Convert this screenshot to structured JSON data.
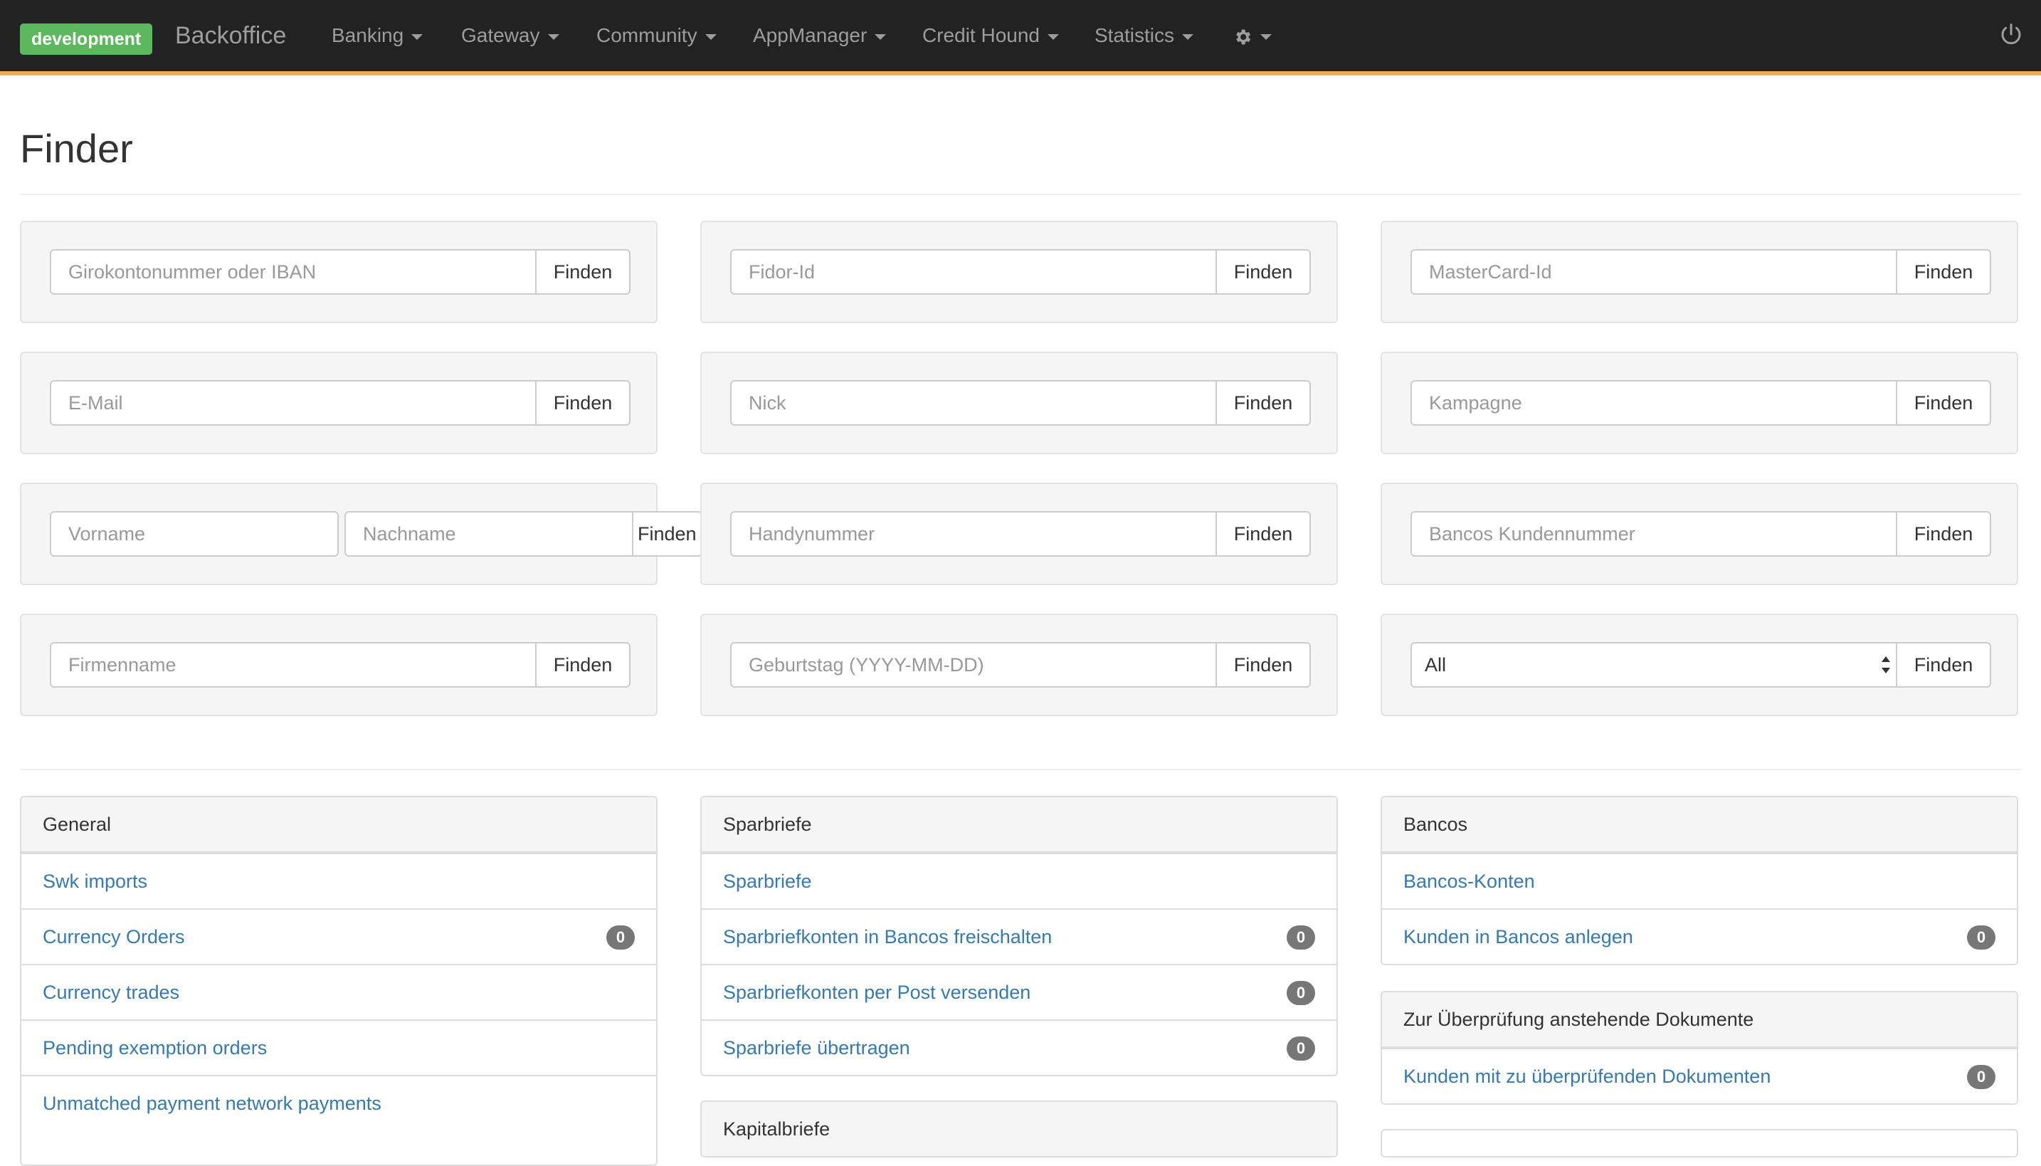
{
  "navbar": {
    "env": "development",
    "brand": "Backoffice",
    "menus": [
      "Banking",
      "Gateway",
      "Community",
      "AppManager",
      "Credit Hound",
      "Statistics"
    ],
    "settings_icon": "gear-icon",
    "logout_icon": "power-icon",
    "accent_color": "#f0ad4e",
    "env_color": "#5cb85c"
  },
  "page": {
    "title": "Finder"
  },
  "finder": {
    "button_label": "Finden",
    "placeholders": {
      "iban": "Girokontonummer oder IBAN",
      "fidor_id": "Fidor-Id",
      "mastercard_id": "MasterCard-Id",
      "email": "E-Mail",
      "nick": "Nick",
      "campaign": "Kampagne",
      "first_name": "Vorname",
      "last_name": "Nachname",
      "mobile": "Handynummer",
      "bancos_number": "Bancos Kundennummer",
      "company": "Firmenname",
      "birthday": "Geburtstag (YYYY-MM-DD)"
    },
    "select_value": "All"
  },
  "panels": {
    "general": {
      "title": "General",
      "items": [
        {
          "label": "Swk imports",
          "count": ""
        },
        {
          "label": "Currency Orders",
          "count": "0"
        },
        {
          "label": "Currency trades",
          "count": ""
        },
        {
          "label": "Pending exemption orders",
          "count": ""
        },
        {
          "label": "Unmatched payment network payments",
          "count": ""
        }
      ]
    },
    "sparbriefe": {
      "title": "Sparbriefe",
      "items": [
        {
          "label": "Sparbriefe",
          "count": ""
        },
        {
          "label": "Sparbriefkonten in Bancos freischalten",
          "count": "0"
        },
        {
          "label": "Sparbriefkonten per Post versenden",
          "count": "0"
        },
        {
          "label": "Sparbriefe übertragen",
          "count": "0"
        }
      ]
    },
    "kapitalbriefe": {
      "title": "Kapitalbriefe"
    },
    "bancos": {
      "title": "Bancos",
      "items": [
        {
          "label": "Bancos-Konten",
          "count": ""
        },
        {
          "label": "Kunden in Bancos anlegen",
          "count": "0"
        }
      ]
    },
    "documents": {
      "title": "Zur Überprüfung anstehende Dokumente",
      "items": [
        {
          "label": "Kunden mit zu überprüfenden Dokumenten",
          "count": "0"
        }
      ]
    }
  }
}
